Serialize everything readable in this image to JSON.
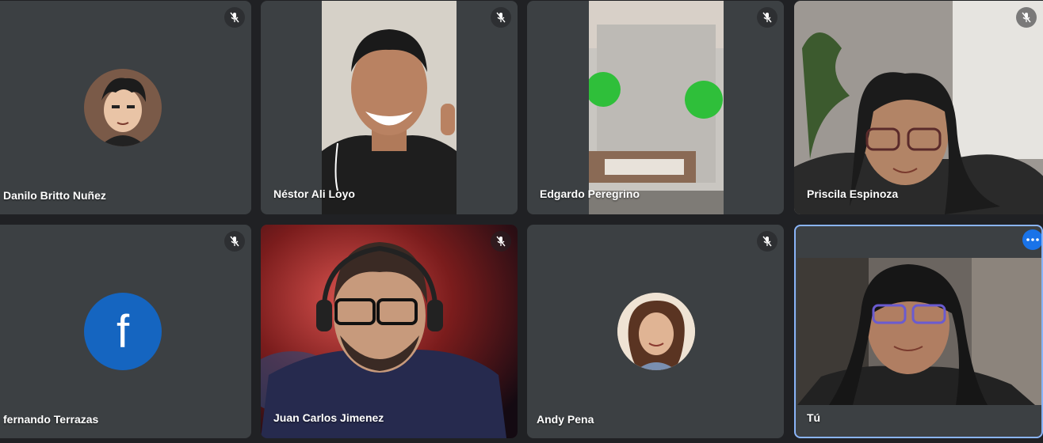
{
  "participants": [
    {
      "name": "Danilo Britto Nuñez",
      "muted": true,
      "display": "avatar"
    },
    {
      "name": "Néstor Ali Loyo",
      "muted": true,
      "display": "video"
    },
    {
      "name": "Edgardo Peregrino",
      "muted": true,
      "display": "video"
    },
    {
      "name": "Priscila Espinoza",
      "muted": true,
      "display": "video"
    },
    {
      "name": "fernando Terrazas",
      "muted": true,
      "display": "avatar",
      "avatar_letter": "f"
    },
    {
      "name": "Juan Carlos Jimenez",
      "muted": true,
      "display": "video"
    },
    {
      "name": "Andy Pena",
      "muted": true,
      "display": "avatar"
    },
    {
      "name": "Tú",
      "muted": false,
      "display": "video",
      "is_self": true
    }
  ],
  "icons": {
    "mute": "mic-off-icon",
    "more": "more-options-icon"
  },
  "colors": {
    "tile_bg": "#3c4043",
    "page_bg": "#202124",
    "facebook_blue": "#1565c0",
    "self_highlight": "#8ab4f8",
    "more_button": "#1a73e8"
  }
}
